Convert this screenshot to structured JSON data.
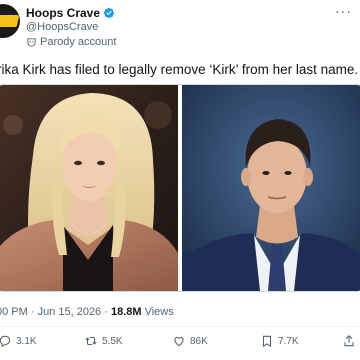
{
  "account": {
    "name": "Hoops Crave",
    "handle": "@HoopsCrave",
    "label": "Parody account"
  },
  "post": {
    "text": "rika Kirk has filed to legally remove ‘Kirk’ from her last name.",
    "timestamp": "00 PM · Jun 15, 2026 · ",
    "views_count": "18.8M",
    "views_label": " Views"
  },
  "actions": {
    "replies": "3.1K",
    "reposts": "5.5K",
    "likes": "86K",
    "bookmarks": "7.7K"
  },
  "colors": {
    "text": "#0f1419",
    "muted": "#536471",
    "verified": "#1d9bf0",
    "brand_yellow": "#f4c21a"
  },
  "icons": [
    "verified-icon",
    "parody-mask-icon",
    "more-icon",
    "reply-icon",
    "repost-icon",
    "like-icon",
    "bookmark-icon",
    "share-icon"
  ]
}
